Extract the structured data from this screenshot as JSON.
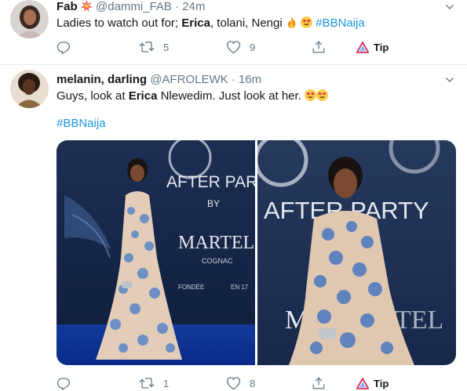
{
  "tweets": [
    {
      "display_name": "Fab",
      "name_emoji": "collision-emoji",
      "handle": "@dammi_FAB",
      "separator": "·",
      "time": "24m",
      "text_pre": "Ladies to watch out for;",
      "text_bold": "Erica",
      "text_post": ", tolani, Nengi",
      "text_emoji": [
        "fire-emoji",
        "heart-eyes-emoji"
      ],
      "hashtag": "#BBNaija",
      "reply_count": "",
      "retweet_count": "5",
      "like_count": "9",
      "tip_label": "Tip"
    },
    {
      "display_name": "melanin, darling",
      "handle": "@AFROLEWK",
      "separator": "·",
      "time": "16m",
      "text_pre": "Guys, look at",
      "text_bold": "Erica",
      "text_post": "Nlewedim. Just look at her.",
      "text_emoji": [
        "heart-eyes-emoji",
        "heart-eyes-emoji"
      ],
      "hashtag": "#BBNaija",
      "media_text_left": [
        "AFTER PAR",
        "BY",
        "MARTELL",
        "COGNAC",
        "FONDÉE",
        "EN 17"
      ],
      "media_text_right": [
        "AFTER PARTY",
        "MA",
        "TEL"
      ],
      "retweet_count": "1",
      "like_count": "8",
      "tip_label": "Tip"
    }
  ],
  "colors": {
    "accent": "#1b95e0",
    "muted": "#657786",
    "text": "#14171a",
    "border": "#e6ecf0",
    "tip": "#e0245e"
  }
}
